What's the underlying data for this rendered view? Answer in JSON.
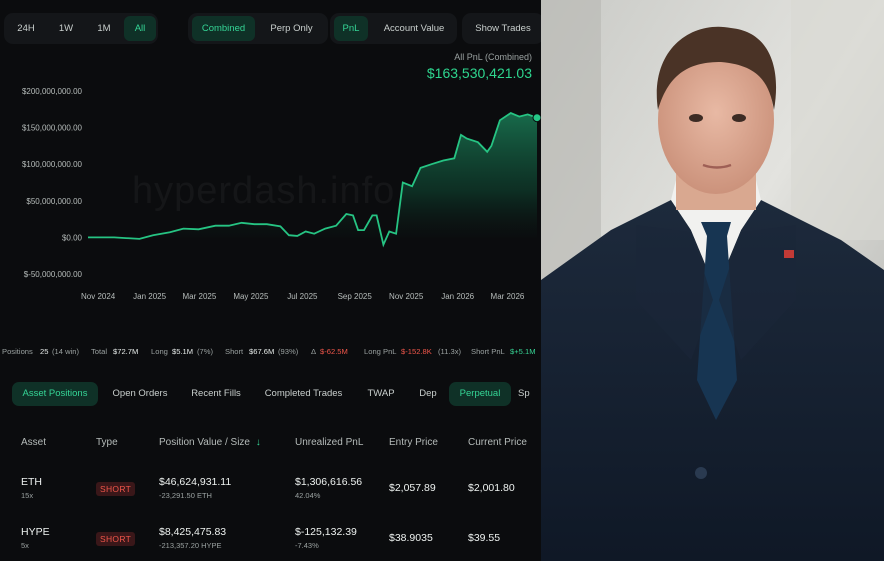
{
  "filters": {
    "time": [
      "24H",
      "1W",
      "1M",
      "All"
    ],
    "mode": [
      "Combined",
      "Perp Only"
    ],
    "metric": [
      "PnL",
      "Account Value"
    ],
    "show_trades": "Show Trades"
  },
  "pnl_header": {
    "label": "All PnL (Combined)",
    "value": "$163,530,421.03"
  },
  "watermark": "hyperdash.info",
  "chart_data": {
    "type": "area",
    "y_ticks": [
      "$200,000,000.00",
      "$150,000,000.00",
      "$100,000,000.00",
      "$50,000,000.00",
      "$0.00",
      "$-50,000,000.00"
    ],
    "x_ticks": [
      "Nov 2024",
      "Jan 2025",
      "Mar 2025",
      "May 2025",
      "Jul 2025",
      "Sep 2025",
      "Nov 2025",
      "Jan 2026",
      "Mar 2026"
    ],
    "ylim": [
      -50000000,
      200000000
    ],
    "color": "#26c483",
    "points": [
      [
        "2024-10-20",
        0
      ],
      [
        "2024-11-20",
        0
      ],
      [
        "2024-12-20",
        -2000000
      ],
      [
        "2025-01-05",
        3000000
      ],
      [
        "2025-01-25",
        7000000
      ],
      [
        "2025-02-10",
        12000000
      ],
      [
        "2025-02-28",
        11000000
      ],
      [
        "2025-03-20",
        16000000
      ],
      [
        "2025-04-05",
        16000000
      ],
      [
        "2025-04-20",
        20000000
      ],
      [
        "2025-05-05",
        18000000
      ],
      [
        "2025-05-20",
        18000000
      ],
      [
        "2025-06-05",
        15000000
      ],
      [
        "2025-06-15",
        3000000
      ],
      [
        "2025-06-25",
        2000000
      ],
      [
        "2025-07-05",
        8000000
      ],
      [
        "2025-07-15",
        5000000
      ],
      [
        "2025-07-28",
        12000000
      ],
      [
        "2025-08-10",
        16000000
      ],
      [
        "2025-08-22",
        32000000
      ],
      [
        "2025-08-30",
        30000000
      ],
      [
        "2025-09-05",
        10000000
      ],
      [
        "2025-09-12",
        10000000
      ],
      [
        "2025-09-22",
        30000000
      ],
      [
        "2025-09-27",
        30000000
      ],
      [
        "2025-10-05",
        -10000000
      ],
      [
        "2025-10-12",
        8000000
      ],
      [
        "2025-10-20",
        5000000
      ],
      [
        "2025-10-28",
        75000000
      ],
      [
        "2025-11-08",
        70000000
      ],
      [
        "2025-11-18",
        95000000
      ],
      [
        "2025-12-01",
        100000000
      ],
      [
        "2025-12-15",
        105000000
      ],
      [
        "2025-12-28",
        108000000
      ],
      [
        "2026-01-05",
        140000000
      ],
      [
        "2026-01-12",
        135000000
      ],
      [
        "2026-01-25",
        130000000
      ],
      [
        "2026-02-05",
        117000000
      ],
      [
        "2026-02-10",
        125000000
      ],
      [
        "2026-02-20",
        160000000
      ],
      [
        "2026-03-05",
        170000000
      ],
      [
        "2026-03-15",
        165000000
      ],
      [
        "2026-03-25",
        168000000
      ],
      [
        "2026-04-05",
        163530421
      ]
    ]
  },
  "stats": {
    "positions_label": "Positions",
    "positions_value": "25",
    "positions_note": "(14 win)",
    "total_label": "Total",
    "total_value": "$72.7M",
    "long_label": "Long",
    "long_value": "$5.1M",
    "long_note": "(7%)",
    "short_label": "Short",
    "short_value": "$67.6M",
    "short_note": "(93%)",
    "delta_label": "Δ",
    "delta_value": "$-62.5M",
    "long_pnl_label": "Long PnL",
    "long_pnl_value": "$-152.8K",
    "long_pnl_note": "(11.3x)",
    "short_pnl_label": "Short PnL",
    "short_pnl_value": "$+5.1M"
  },
  "tabs": [
    "Asset Positions",
    "Open Orders",
    "Recent Fills",
    "Completed Trades",
    "TWAP",
    "Dep",
    "Perpetual",
    "Sp"
  ],
  "table": {
    "headers": [
      "Asset",
      "Type",
      "Position Value / Size",
      "Unrealized PnL",
      "Entry Price",
      "Current Price"
    ],
    "rows": [
      {
        "asset": "ETH",
        "leverage": "15x",
        "type": "SHORT",
        "value": "$46,624,931.11",
        "size": "-23,291.50 ETH",
        "pnl": "$1,306,616.56",
        "pnl_pct": "42.04%",
        "entry": "$2,057.89",
        "current": "$2,001.80"
      },
      {
        "asset": "HYPE",
        "leverage": "5x",
        "type": "SHORT",
        "value": "$8,425,475.83",
        "size": "-213,357.20 HYPE",
        "pnl": "$-125,132.39",
        "pnl_pct": "-7.43%",
        "entry": "$38.9035",
        "current": "$39.55"
      }
    ]
  }
}
